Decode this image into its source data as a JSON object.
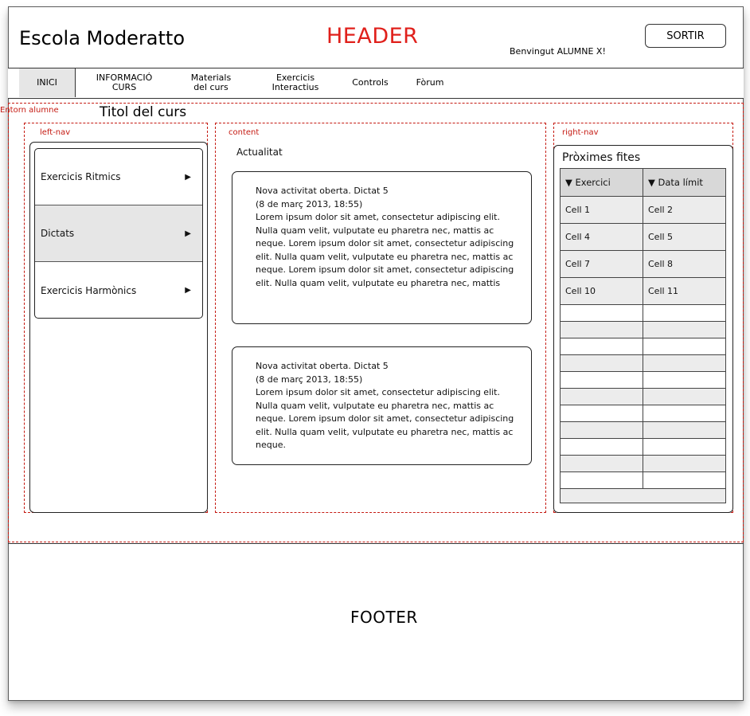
{
  "header": {
    "brand": "Escola Moderatto",
    "label": "HEADER",
    "welcome": "Benvingut ALUMNE X!",
    "logout_label": "SORTIR"
  },
  "nav": {
    "items": [
      {
        "line1": "INICI",
        "line2": ""
      },
      {
        "line1": "INFORMACIÓ",
        "line2": "CURS"
      },
      {
        "line1": "Materials",
        "line2": "del curs"
      },
      {
        "line1": "Exercicis",
        "line2": "Interactius"
      },
      {
        "line1": "Controls",
        "line2": ""
      },
      {
        "line1": "Fòrum",
        "line2": ""
      }
    ]
  },
  "regions": {
    "environment": "Entorn alumne",
    "left_nav": "left-nav",
    "content": "content",
    "right_nav": "right-nav"
  },
  "course": {
    "title": "Titol del curs"
  },
  "left_menu": {
    "items": [
      {
        "label": "Exercicis Ritmics",
        "arrow": "▶"
      },
      {
        "label": "Dictats",
        "arrow": "▶"
      },
      {
        "label": "Exercicis Harmònics",
        "arrow": "▶"
      }
    ]
  },
  "content": {
    "heading": "Actualitat",
    "news": [
      {
        "title": "Nova activitat oberta. Dictat 5",
        "date": "(8 de març 2013, 18:55)",
        "body": "Lorem ipsum dolor sit amet, consectetur adipiscing elit. Nulla quam velit, vulputate eu pharetra nec, mattis ac neque. Lorem ipsum dolor sit amet, consectetur adipiscing elit. Nulla quam velit, vulputate eu pharetra nec, mattis ac neque. Lorem ipsum dolor sit amet, consectetur adipiscing elit. Nulla quam velit, vulputate eu pharetra nec, mattis"
      },
      {
        "title": "Nova activitat oberta. Dictat 5",
        "date": "(8 de març 2013, 18:55)",
        "body": "Lorem ipsum dolor sit amet, consectetur adipiscing elit. Nulla quam velit, vulputate eu pharetra nec, mattis ac neque. Lorem ipsum dolor sit amet, consectetur adipiscing elit. Nulla quam velit, vulputate eu pharetra nec, mattis ac neque."
      }
    ]
  },
  "milestones": {
    "title": "Pròximes fites",
    "columns": [
      "▼ Exercici",
      "▼ Data límit"
    ],
    "rows": [
      [
        "Cell 1",
        "Cell 2"
      ],
      [
        "Cell 4",
        "Cell 5"
      ],
      [
        "Cell 7",
        "Cell 8"
      ],
      [
        "Cell 10",
        "Cell 11"
      ]
    ]
  },
  "footer": {
    "label": "FOOTER"
  }
}
